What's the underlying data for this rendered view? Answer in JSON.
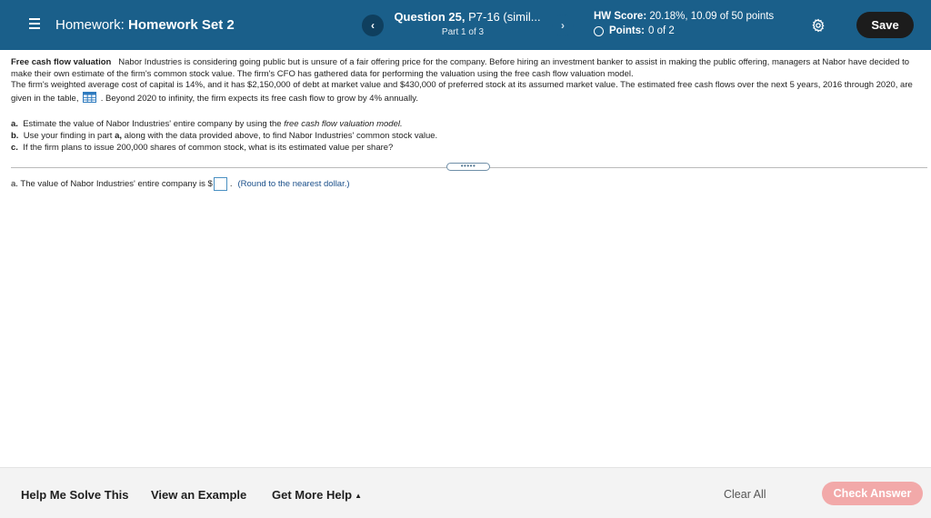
{
  "header": {
    "homework_label": "Homework:",
    "homework_name": "Homework Set 2",
    "question_label": "Question 25,",
    "question_id": "P7-16 (simil...",
    "part": "Part 1 of 3",
    "prev_glyph": "‹",
    "next_glyph": "›",
    "score_label": "HW Score:",
    "score_value": "20.18%, 10.09 of 50 points",
    "points_label": "Points:",
    "points_value": "0 of 2",
    "save_label": "Save",
    "brand_color": "#1a5f8a"
  },
  "problem": {
    "title": "Free cash flow valuation",
    "text_1": "Nabor Industries is considering going public but is unsure of a fair offering price for the company. Before hiring an investment banker to assist in making the public offering, managers at Nabor have decided to make their own estimate of the firm's common stock value. The firm's CFO has gathered data for performing the valuation using the free cash flow valuation model.",
    "text_2": "The firm's weighted average cost of capital is 14%, and it has $2,150,000 of debt at market value and $430,000 of preferred stock at its assumed market value.  The estimated free cash flows over the next 5 years, 2016 through 2020, are given in the table,",
    "text_3": ".  Beyond 2020 to infinity, the firm expects its free cash flow to grow by 4% annually.",
    "parts": {
      "a_label": "a.",
      "a_text": "Estimate the value of Nabor Industries' entire company by using the",
      "a_italic": "free cash flow valuation model.",
      "b_label": "b.",
      "b_text_1": "Use your finding in part",
      "b_bold": "a,",
      "b_text_2": "along with the data provided above, to find Nabor Industries' common stock value.",
      "c_label": "c.",
      "c_text": "If the firm plans to issue 200,000 shares of common stock, what is its estimated value per share?"
    },
    "expander_dots": "•••••"
  },
  "answer": {
    "prefix": "a.  The value of Nabor Industries' entire company is $",
    "suffix": ".",
    "input_value": "",
    "hint": "(Round to the nearest dollar.)"
  },
  "footer": {
    "help_solve": "Help Me Solve This",
    "view_example": "View an Example",
    "more_help": "Get More Help",
    "more_help_arrow": "▲",
    "clear_all": "Clear All",
    "check_answer": "Check Answer"
  }
}
